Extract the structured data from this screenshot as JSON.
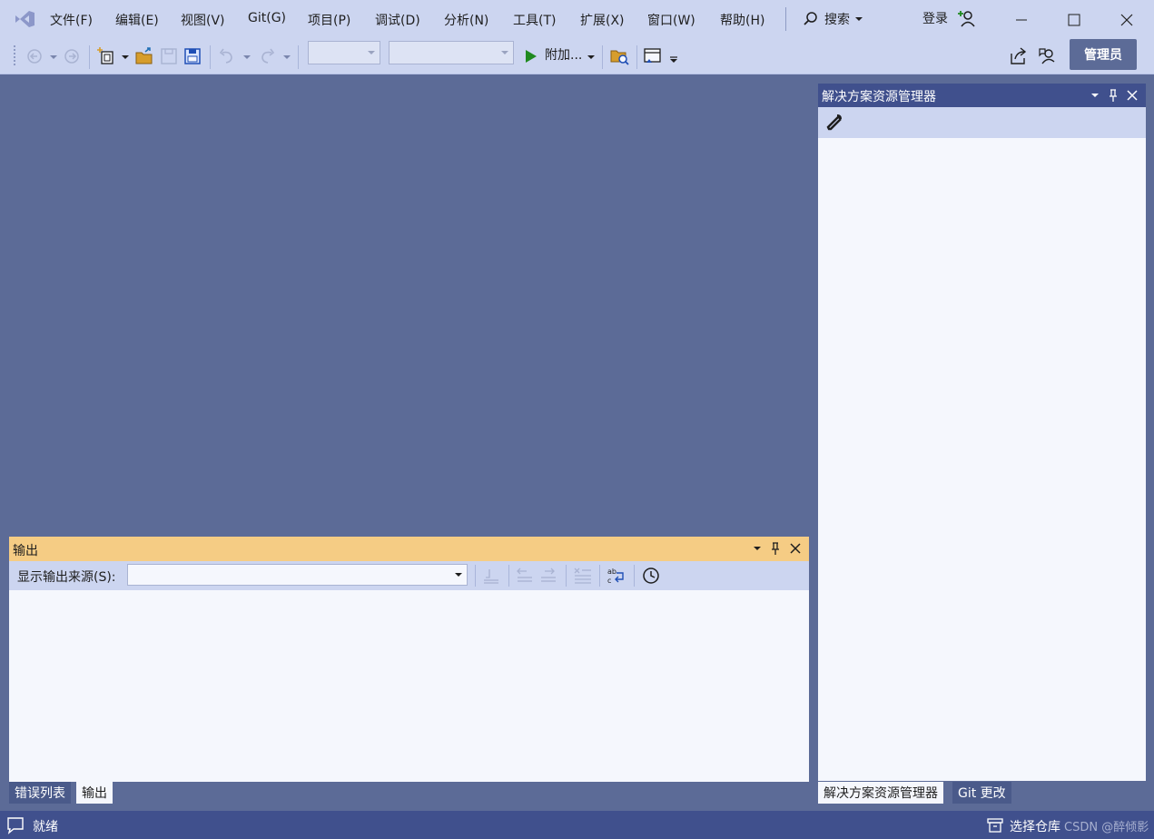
{
  "menu": {
    "items": [
      "文件(F)",
      "编辑(E)",
      "视图(V)",
      "Git(G)",
      "项目(P)",
      "调试(D)",
      "分析(N)",
      "工具(T)",
      "扩展(X)",
      "窗口(W)",
      "帮助(H)"
    ],
    "search_label": "搜索",
    "login_label": "登录"
  },
  "toolbar": {
    "attach_label": "附加...",
    "admin_label": "管理员"
  },
  "solution_explorer": {
    "title": "解决方案资源管理器"
  },
  "output": {
    "title": "输出",
    "source_label": "显示输出来源(S):",
    "source_value": ""
  },
  "bottom_tabs": {
    "left": [
      {
        "label": "错误列表",
        "active": false
      },
      {
        "label": "输出",
        "active": true
      }
    ],
    "right": [
      {
        "label": "解决方案资源管理器",
        "active": true
      },
      {
        "label": "Git 更改",
        "active": false
      }
    ]
  },
  "status": {
    "text": "就绪",
    "repo_label": "选择仓库",
    "watermark": "CSDN @醉倾影"
  },
  "colors": {
    "workspace": "#5c6b97",
    "chrome": "#ccd5f0",
    "accent_dark": "#40508d",
    "output_header": "#f5cc84",
    "run_green": "#1f8a1f"
  }
}
